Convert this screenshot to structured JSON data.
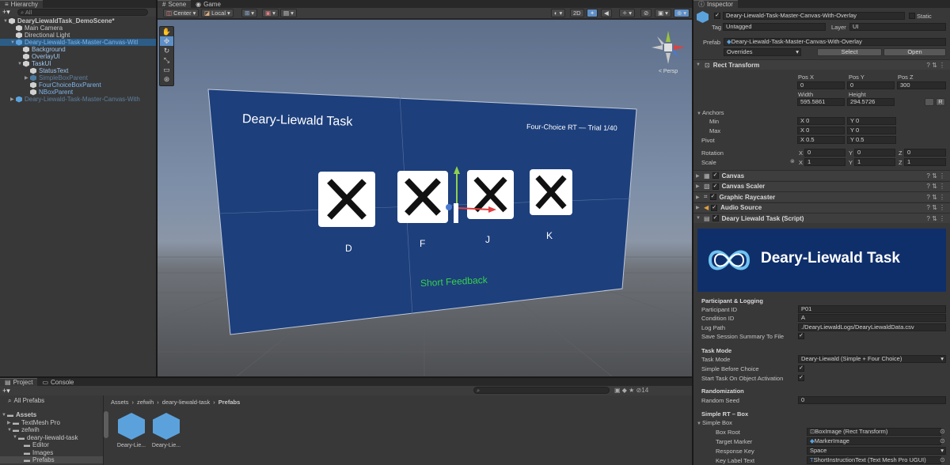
{
  "hierarchy": {
    "tab": "Hierarchy",
    "search_placeholder": "All",
    "items": [
      {
        "label": "DearyLiewaldTask_DemoScene*",
        "indent": 0
      },
      {
        "label": "Main Camera",
        "indent": 1
      },
      {
        "label": "Directional Light",
        "indent": 1
      },
      {
        "label": "Deary-Liewald-Task-Master-Canvas-Witl",
        "indent": 1
      },
      {
        "label": "Background",
        "indent": 2
      },
      {
        "label": "OverlayUI",
        "indent": 2
      },
      {
        "label": "TaskUI",
        "indent": 2
      },
      {
        "label": "StatusText",
        "indent": 3
      },
      {
        "label": "SimpleBoxParent",
        "indent": 3
      },
      {
        "label": "FourChoiceBoxParent",
        "indent": 3
      },
      {
        "label": "NBoxParent",
        "indent": 3
      },
      {
        "label": "Deary-Liewald-Task-Master-Canvas-With",
        "indent": 1
      }
    ]
  },
  "scene": {
    "tabs": [
      "Scene",
      "Game"
    ],
    "pivot_mode": "Center",
    "space_mode": "Local",
    "mode_2d": "2D",
    "persp_label": "< Persp"
  },
  "canvas_ui": {
    "title": "Deary-Liewald Task",
    "trial": "Four-Choice RT —  Trial 1/40",
    "keys": [
      "D",
      "F",
      "J",
      "K"
    ],
    "feedback": "Short Feedback"
  },
  "project": {
    "tabs": [
      "Project",
      "Console"
    ],
    "all_prefabs": "All Prefabs",
    "tree": [
      {
        "label": "Assets",
        "indent": 0,
        "bold": true
      },
      {
        "label": "TextMesh Pro",
        "indent": 1
      },
      {
        "label": "zefwih",
        "indent": 1
      },
      {
        "label": "deary-liewald-task",
        "indent": 2
      },
      {
        "label": "Editor",
        "indent": 3
      },
      {
        "label": "Images",
        "indent": 3
      },
      {
        "label": "Prefabs",
        "indent": 3
      }
    ],
    "breadcrumb": [
      "Assets",
      "zefwih",
      "deary-liewald-task",
      "Prefabs"
    ],
    "assets": [
      "Deary-Lie...",
      "Deary-Lie..."
    ],
    "count": "14"
  },
  "inspector": {
    "tab": "Inspector",
    "object_name": "Deary-Liewald-Task-Master-Canvas-With-Overlay",
    "static_label": "Static",
    "tag_label": "Tag",
    "tag_value": "Untagged",
    "layer_label": "Layer",
    "layer_value": "UI",
    "prefab_label": "Prefab",
    "prefab_value": "Deary-Liewald-Task-Master-Canvas-With-Overlay",
    "overrides": "Overrides",
    "select": "Select",
    "open": "Open",
    "rect_transform": {
      "title": "Rect Transform",
      "pos_x_label": "Pos X",
      "pos_y_label": "Pos Y",
      "pos_z_label": "Pos Z",
      "pos_x": "0",
      "pos_y": "0",
      "pos_z": "300",
      "width_label": "Width",
      "height_label": "Height",
      "width": "595.5861",
      "height": "294.5726",
      "anchors": "Anchors",
      "min": "Min",
      "max": "Max",
      "min_x": "0",
      "min_y": "0",
      "max_x": "0",
      "max_y": "0",
      "pivot": "Pivot",
      "pivot_x": "0.5",
      "pivot_y": "0.5",
      "rotation": "Rotation",
      "rot_x": "0",
      "rot_y": "0",
      "rot_z": "0",
      "scale": "Scale",
      "scale_x": "1",
      "scale_y": "1",
      "scale_z": "1",
      "x": "X",
      "y": "Y",
      "z": "Z"
    },
    "components": [
      "Canvas",
      "Canvas Scaler",
      "Graphic Raycaster",
      "Audio Source",
      "Deary Liewald Task (Script)"
    ],
    "banner_title": "Deary-Liewald Task",
    "sections": {
      "participant": "Participant & Logging",
      "task_mode": "Task Mode",
      "randomization": "Randomization",
      "simple_rt": "Simple RT – Box"
    },
    "fields": {
      "participant_id_label": "Participant ID",
      "participant_id": "P01",
      "condition_id_label": "Condition ID",
      "condition_id": "A",
      "log_path_label": "Log Path",
      "log_path": "./DearyLiewaldLogs/DearyLiewaldData.csv",
      "save_summary_label": "Save Session Summary To File",
      "task_mode_label": "Task Mode",
      "task_mode": "Deary-Liewald (Simple + Four Choice)",
      "simple_before_label": "Simple Before Choice",
      "start_on_activation_label": "Start Task On Object Activation",
      "random_seed_label": "Random Seed",
      "random_seed": "0",
      "simple_box_label": "Simple Box",
      "box_root_label": "Box Root",
      "box_root": "BoxImage (Rect Transform)",
      "target_marker_label": "Target Marker",
      "target_marker": "MarkerImage",
      "response_key_label": "Response Key",
      "response_key": "Space",
      "key_label_text_label": "Key Label Text",
      "key_label_text": "ShortInstructionText (Text Mesh Pro UGUI)"
    }
  }
}
